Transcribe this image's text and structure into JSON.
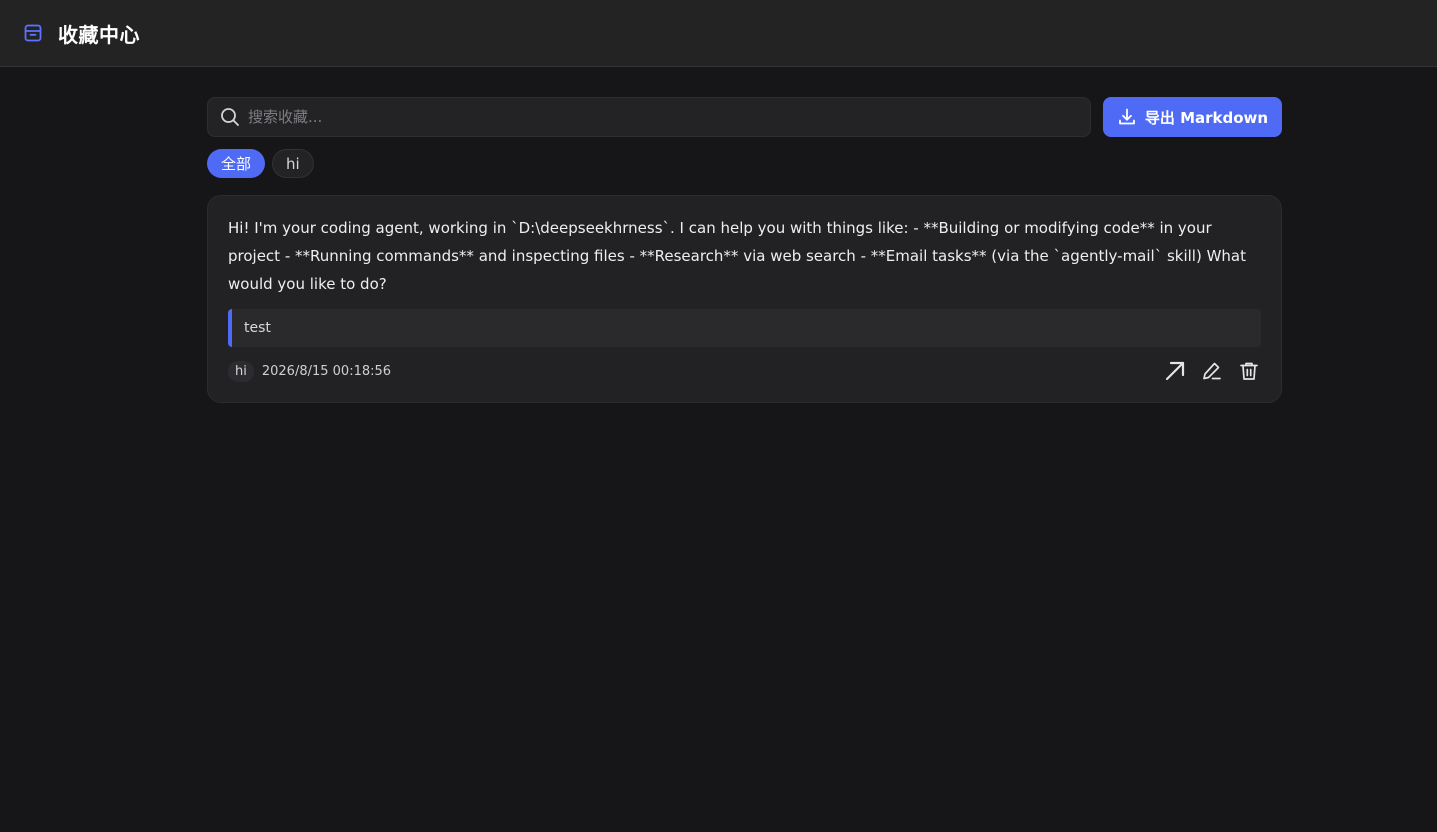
{
  "header": {
    "title": "收藏中心",
    "icon": "archive-box-icon",
    "accent": "#4f6bf5"
  },
  "search": {
    "placeholder": "搜索收藏...",
    "value": ""
  },
  "toolbar": {
    "export_label": "导出 Markdown",
    "export_icon": "download-icon"
  },
  "filters": {
    "tags": [
      {
        "label": "全部",
        "active": true
      },
      {
        "label": "hi",
        "active": false
      }
    ]
  },
  "items": [
    {
      "content": "Hi! I'm your coding agent, working in `D:\\deepseekhrness`. I can help you with things like: - **Building or modifying code** in your project - **Running commands** and inspecting files - **Research** via web search - **Email tasks** (via the `agently-mail` skill) What would you like to do?",
      "note": "test",
      "tag": "hi",
      "timestamp": "2026/8/15 00:18:56",
      "actions": [
        "open-icon",
        "edit-icon",
        "delete-icon"
      ]
    }
  ]
}
